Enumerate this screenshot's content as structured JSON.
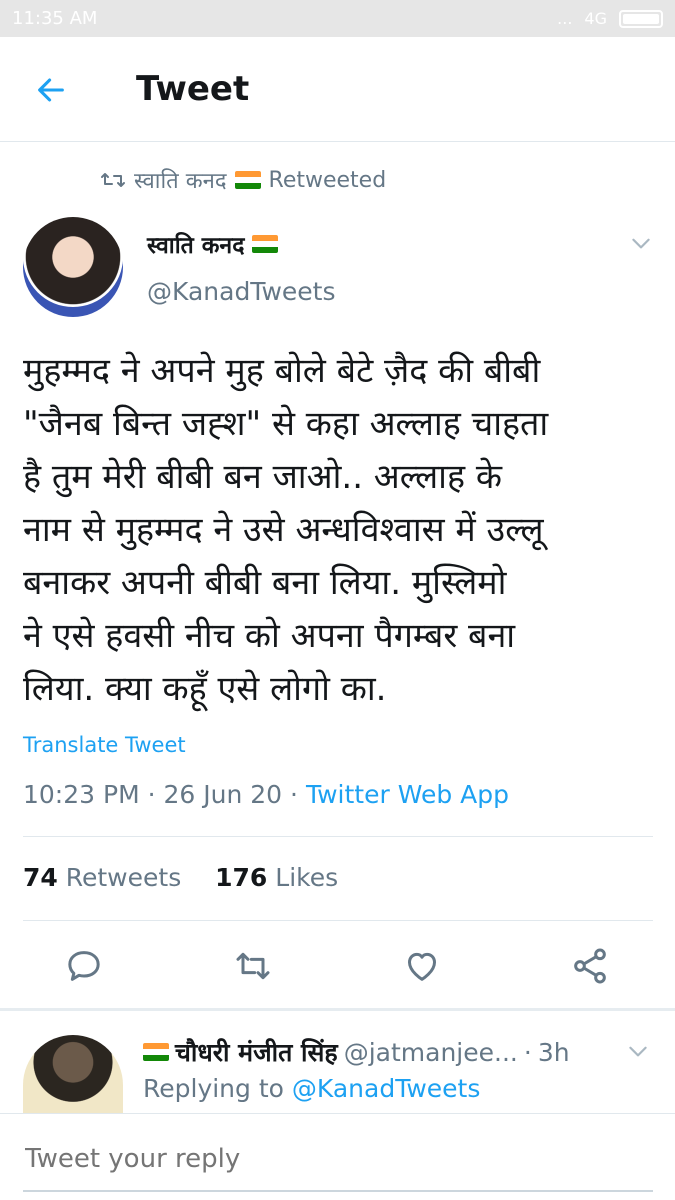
{
  "status_bar": {
    "time": "11:35 AM",
    "network": "4G",
    "extra": "..."
  },
  "header": {
    "title": "Tweet"
  },
  "retweet_line": {
    "name": "स्वाति कनद",
    "label": "Retweeted"
  },
  "tweet": {
    "author_name": "स्वाति कनद",
    "handle": "@KanadTweets",
    "text": "मुहम्मद ने अपने मुह बोले  बेटे ज़ैद  की बीबी\n\"जैनब बिन्त जह्श\" से कहा अल्लाह चाहता\nहै तुम मेरी बीबी बन जाओ.. अल्लाह के\nनाम से मुहम्मद ने उसे अन्धविश्वास में उल्लू\nबनाकर अपनी बीबी बना लिया. मुस्लिमो\nने एसे हवसी नीच को अपना पैगम्बर बना\nलिया. क्या कहूँ एसे लोगो का.",
    "translate": "Translate Tweet",
    "time": "10:23 PM",
    "date": "26 Jun 20",
    "source": "Twitter Web App",
    "retweets_count": "74",
    "retweets_label": "Retweets",
    "likes_count": "176",
    "likes_label": "Likes"
  },
  "reply": {
    "name": "चौधरी मंजीत सिंह",
    "handle": "@jatmanjee...",
    "age": "3h",
    "replying_prefix": "Replying to",
    "replying_to": "@KanadTweets"
  },
  "compose": {
    "placeholder": "Tweet your reply"
  },
  "colors": {
    "accent": "#1da1f2",
    "secondary_text": "#657786",
    "divider": "#e1e8ed"
  },
  "icons": [
    "back-arrow-icon",
    "retweet-icon",
    "india-flag-icon",
    "chevron-down-icon",
    "reply-icon",
    "like-icon",
    "share-icon"
  ]
}
